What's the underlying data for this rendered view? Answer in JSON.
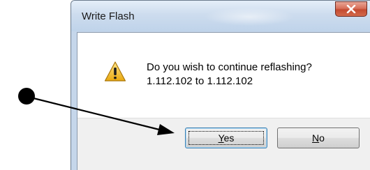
{
  "window": {
    "title": "Write Flash",
    "close_label": "close"
  },
  "dialog": {
    "icon": "warning-icon",
    "message_line1": "Do you wish to continue reflashing?",
    "message_line2": "1.112.102 to 1.112.102"
  },
  "buttons": {
    "yes_mnemonic": "Y",
    "yes_rest": "es",
    "no_mnemonic": "N",
    "no_rest": "o"
  },
  "annotation": {
    "marker": "black-dot-with-arrow"
  },
  "colors": {
    "close_button": "#c34a31",
    "titlebar": "#cddcee",
    "focus_border": "#3c7fb1",
    "warning_fill": "#f2c12e"
  }
}
